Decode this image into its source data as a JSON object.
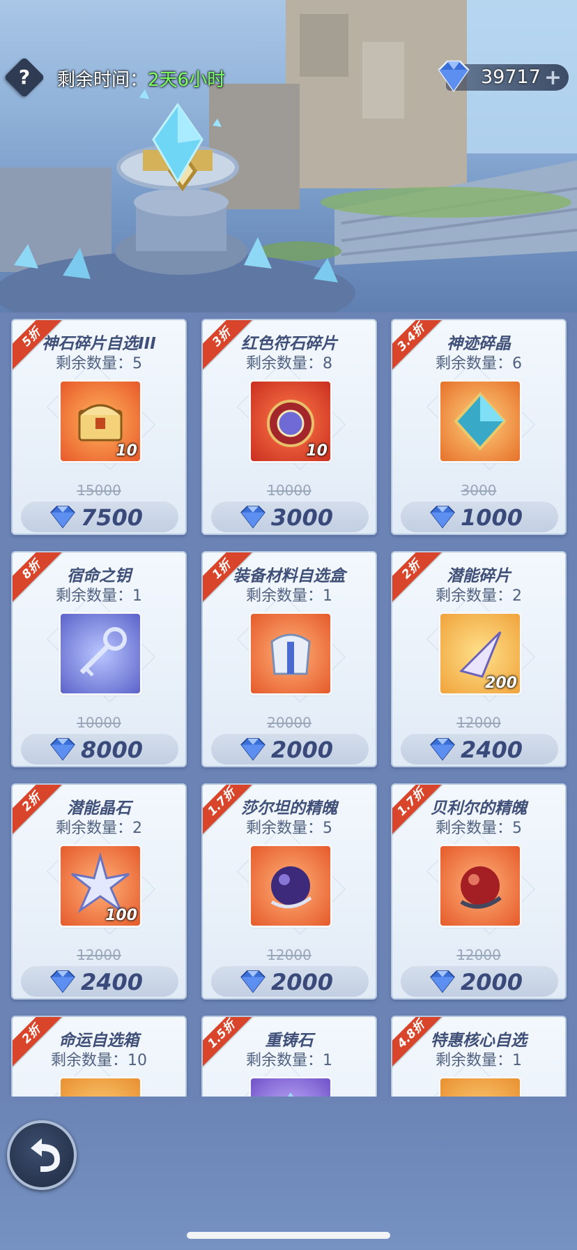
{
  "header": {
    "help_icon": "question-icon",
    "timer_label": "剩余时间：",
    "timer_value": "2天6小时",
    "currency_amount": "39717",
    "currency_plus": "+",
    "currency_icon": "diamond-icon"
  },
  "items": [
    {
      "discount": "5折",
      "name": "神石碎片自选III",
      "stock": "剩余数量：5",
      "qty": "10",
      "old_price": "15000",
      "price": "7500",
      "icon": "treasure-chest-icon"
    },
    {
      "discount": "3折",
      "name": "红色符石碎片",
      "stock": "剩余数量：8",
      "qty": "10",
      "old_price": "10000",
      "price": "3000",
      "icon": "red-rune-icon"
    },
    {
      "discount": "3.4折",
      "name": "神迹碎晶",
      "stock": "剩余数量：6",
      "qty": "",
      "old_price": "3000",
      "price": "1000",
      "icon": "crystal-icon"
    },
    {
      "discount": "8折",
      "name": "宿命之钥",
      "stock": "剩余数量：1",
      "qty": "",
      "old_price": "10000",
      "price": "8000",
      "icon": "key-icon"
    },
    {
      "discount": "1折",
      "name": "装备材料自选盒",
      "stock": "剩余数量：1",
      "qty": "",
      "old_price": "20000",
      "price": "2000",
      "icon": "armor-icon"
    },
    {
      "discount": "2折",
      "name": "潜能碎片",
      "stock": "剩余数量：2",
      "qty": "200",
      "old_price": "12000",
      "price": "2400",
      "icon": "shard-icon"
    },
    {
      "discount": "2折",
      "name": "潜能晶石",
      "stock": "剩余数量：2",
      "qty": "100",
      "old_price": "12000",
      "price": "2400",
      "icon": "star-crystal-icon"
    },
    {
      "discount": "1.7折",
      "name": "莎尔坦的精魄",
      "stock": "剩余数量：5",
      "qty": "",
      "old_price": "12000",
      "price": "2000",
      "icon": "purple-orb-icon"
    },
    {
      "discount": "1.7折",
      "name": "贝利尔的精魄",
      "stock": "剩余数量：5",
      "qty": "",
      "old_price": "12000",
      "price": "2000",
      "icon": "red-orb-icon"
    },
    {
      "discount": "2折",
      "name": "命运自选箱",
      "stock": "剩余数量：10",
      "qty": "",
      "old_price": "",
      "price": "",
      "icon": "fate-box-icon"
    },
    {
      "discount": "1.5折",
      "name": "重铸石",
      "stock": "剩余数量：1",
      "qty": "",
      "old_price": "",
      "price": "",
      "icon": "reforge-stone-icon"
    },
    {
      "discount": "4.8折",
      "name": "特惠核心自选",
      "stock": "剩余数量：1",
      "qty": "",
      "old_price": "",
      "price": "",
      "icon": "core-icon"
    }
  ],
  "footer": {
    "back_icon": "back-arrow-icon"
  },
  "colors": {
    "ribbon": "#d9452a",
    "price_text": "#39497a",
    "timer_value": "#7dff64",
    "gem": "#3b6fd8"
  }
}
